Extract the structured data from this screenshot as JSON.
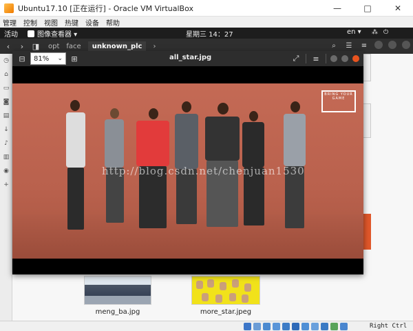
{
  "window": {
    "title": "Ubuntu17.10 [正在运行] - Oracle VM VirtualBox",
    "min": "—",
    "max": "□",
    "close": "✕"
  },
  "vbox_menu": [
    "管理",
    "控制",
    "视图",
    "热键",
    "设备",
    "帮助"
  ],
  "ubuntu_panel": {
    "activities": "活动",
    "app_name": "图像查看器 ▾",
    "clock": "星期三 14：27",
    "lang": "en ▾"
  },
  "files": {
    "breadcrumbs": [
      "opt",
      "face",
      "unknown_plc"
    ],
    "thumbnails": [
      {
        "label": "meng_ba.jpg"
      },
      {
        "label": "more_star.jpeg"
      }
    ]
  },
  "viewer": {
    "zoom": "81%",
    "title": "all_star.jpg",
    "logo_text": "BRING YOUR GAME",
    "watermark": "http://blog.csdn.net/chenjuan1530"
  },
  "statusbar": {
    "host_key": "Right Ctrl"
  },
  "colors": {
    "accent_close": "#e9541f",
    "photo_bg": "#c46a55",
    "thumb_yellow": "#f1e21a"
  }
}
